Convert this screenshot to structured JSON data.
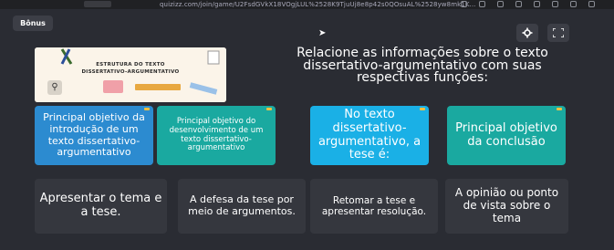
{
  "browser": {
    "url": "quizizz.com/join/game/U2FsdGVkX18VOgjLUL%2528K9TjuUj8e8p42s0QOsuAL%2528yw8mk1K..."
  },
  "header": {
    "bonus_label": "Bônus"
  },
  "image_card": {
    "line1": "ESTRUTURA DO TEXTO",
    "line2": "DISSERTATIVO-ARGUMENTATIVO"
  },
  "question": "Relacione as informações sobre o texto dissertativo-argumentativo com suas respectivas funções:",
  "top_cards": [
    {
      "text": "Principal objetivo da introdução de um texto dissertativo-argumentativo",
      "color": "#2c8bd0"
    },
    {
      "text": "Principal objetivo do desenvolvimento de um texto dissertativo-argumentativo",
      "color": "#1aa9a0"
    },
    {
      "text": "No texto dissertativo-argumentativo, a tese é:",
      "color": "#1ab0e6"
    },
    {
      "text": "Principal objetivo da conclusão",
      "color": "#1aa9a0"
    }
  ],
  "bottom_cards": [
    {
      "text": "Apresentar o tema e a tese."
    },
    {
      "text": "A defesa da tese por meio de argumentos."
    },
    {
      "text": "Retomar a tese e apresentar resolução."
    },
    {
      "text": "A opinião ou ponto de vista sobre o tema"
    }
  ],
  "icons": {
    "settings": "gear-icon",
    "fullscreen": "fullscreen-icon",
    "zoom": "zoom-icon",
    "cursor": "cursor-icon"
  }
}
